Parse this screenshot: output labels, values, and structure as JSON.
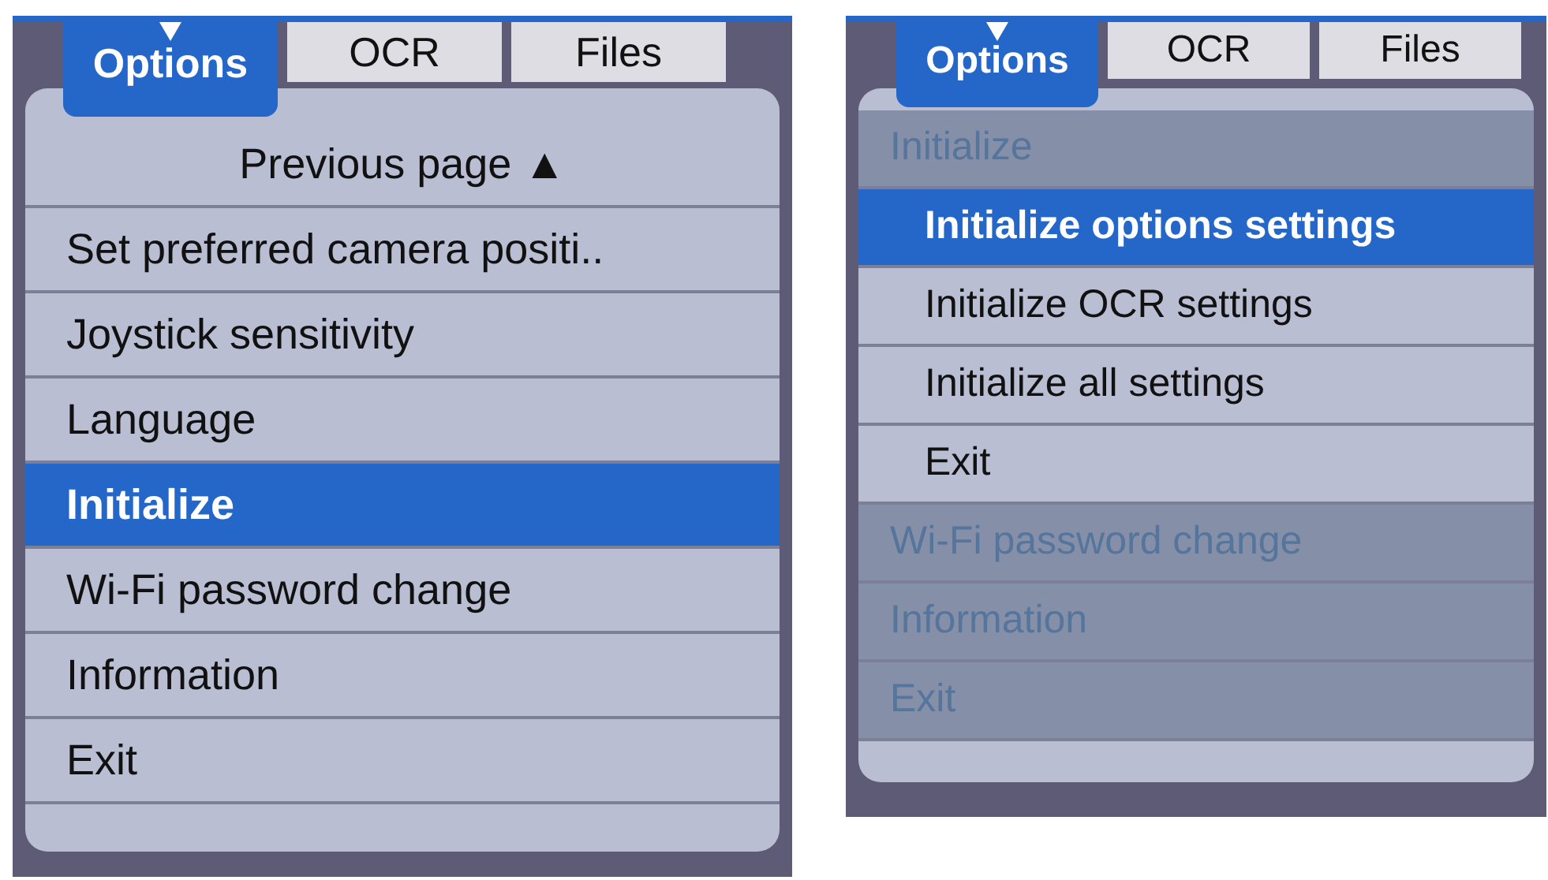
{
  "panels": [
    {
      "tabs": [
        {
          "label": "Options",
          "selected": true
        },
        {
          "label": "OCR",
          "selected": false
        },
        {
          "label": "Files",
          "selected": false
        }
      ],
      "items": [
        {
          "label": "Previous page ▲",
          "kind": "nav",
          "selected": false,
          "disabled": false
        },
        {
          "label": "Set preferred camera positi..",
          "kind": "item",
          "selected": false,
          "disabled": false
        },
        {
          "label": "Joystick sensitivity",
          "kind": "item",
          "selected": false,
          "disabled": false
        },
        {
          "label": "Language",
          "kind": "item",
          "selected": false,
          "disabled": false
        },
        {
          "label": "Initialize",
          "kind": "item",
          "selected": true,
          "disabled": false
        },
        {
          "label": "Wi-Fi password change",
          "kind": "item",
          "selected": false,
          "disabled": false
        },
        {
          "label": "Information",
          "kind": "item",
          "selected": false,
          "disabled": false
        },
        {
          "label": "Exit",
          "kind": "item",
          "selected": false,
          "disabled": false
        }
      ]
    },
    {
      "tabs": [
        {
          "label": "Options",
          "selected": true
        },
        {
          "label": "OCR",
          "selected": false
        },
        {
          "label": "Files",
          "selected": false
        }
      ],
      "items": [
        {
          "label": "Initialize",
          "kind": "item",
          "selected": false,
          "disabled": true,
          "children": [
            {
              "label": "Initialize options settings",
              "kind": "subitem",
              "selected": true,
              "disabled": false
            },
            {
              "label": "Initialize OCR settings",
              "kind": "subitem",
              "selected": false,
              "disabled": false
            },
            {
              "label": "Initialize all settings",
              "kind": "subitem",
              "selected": false,
              "disabled": false
            },
            {
              "label": "Exit",
              "kind": "subitem",
              "selected": false,
              "disabled": false
            }
          ]
        },
        {
          "label": "Wi-Fi password change",
          "kind": "item",
          "selected": false,
          "disabled": true
        },
        {
          "label": "Information",
          "kind": "item",
          "selected": false,
          "disabled": true
        },
        {
          "label": "Exit",
          "kind": "item",
          "selected": false,
          "disabled": true
        }
      ]
    }
  ]
}
